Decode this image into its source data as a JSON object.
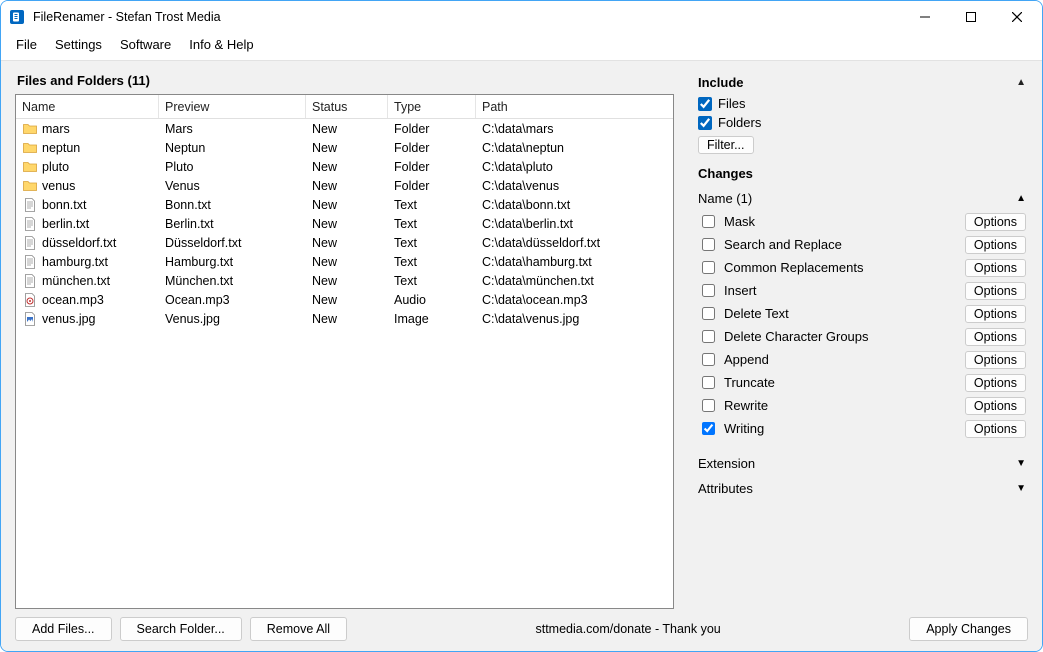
{
  "title": "FileRenamer - Stefan Trost Media",
  "menu": [
    "File",
    "Settings",
    "Software",
    "Info & Help"
  ],
  "files_section_title": "Files and Folders (11)",
  "columns": [
    "Name",
    "Preview",
    "Status",
    "Type",
    "Path"
  ],
  "rows": [
    {
      "icon": "folder",
      "name": "mars",
      "preview": "Mars",
      "status": "New",
      "type": "Folder",
      "path": "C:\\data\\mars"
    },
    {
      "icon": "folder",
      "name": "neptun",
      "preview": "Neptun",
      "status": "New",
      "type": "Folder",
      "path": "C:\\data\\neptun"
    },
    {
      "icon": "folder",
      "name": "pluto",
      "preview": "Pluto",
      "status": "New",
      "type": "Folder",
      "path": "C:\\data\\pluto"
    },
    {
      "icon": "folder",
      "name": "venus",
      "preview": "Venus",
      "status": "New",
      "type": "Folder",
      "path": "C:\\data\\venus"
    },
    {
      "icon": "text",
      "name": "bonn.txt",
      "preview": "Bonn.txt",
      "status": "New",
      "type": "Text",
      "path": "C:\\data\\bonn.txt"
    },
    {
      "icon": "text",
      "name": "berlin.txt",
      "preview": "Berlin.txt",
      "status": "New",
      "type": "Text",
      "path": "C:\\data\\berlin.txt"
    },
    {
      "icon": "text",
      "name": "düsseldorf.txt",
      "preview": "Düsseldorf.txt",
      "status": "New",
      "type": "Text",
      "path": "C:\\data\\düsseldorf.txt"
    },
    {
      "icon": "text",
      "name": "hamburg.txt",
      "preview": "Hamburg.txt",
      "status": "New",
      "type": "Text",
      "path": "C:\\data\\hamburg.txt"
    },
    {
      "icon": "text",
      "name": "münchen.txt",
      "preview": "München.txt",
      "status": "New",
      "type": "Text",
      "path": "C:\\data\\münchen.txt"
    },
    {
      "icon": "audio",
      "name": "ocean.mp3",
      "preview": "Ocean.mp3",
      "status": "New",
      "type": "Audio",
      "path": "C:\\data\\ocean.mp3"
    },
    {
      "icon": "image",
      "name": "venus.jpg",
      "preview": "Venus.jpg",
      "status": "New",
      "type": "Image",
      "path": "C:\\data\\venus.jpg"
    }
  ],
  "include": {
    "title": "Include",
    "files_label": "Files",
    "files_checked": true,
    "folders_label": "Folders",
    "folders_checked": true,
    "filter_button": "Filter..."
  },
  "changes": {
    "title": "Changes",
    "name_header": "Name (1)",
    "items": [
      {
        "label": "Mask",
        "checked": false
      },
      {
        "label": "Search and Replace",
        "checked": false
      },
      {
        "label": "Common Replacements",
        "checked": false
      },
      {
        "label": "Insert",
        "checked": false
      },
      {
        "label": "Delete Text",
        "checked": false
      },
      {
        "label": "Delete Character Groups",
        "checked": false
      },
      {
        "label": "Append",
        "checked": false
      },
      {
        "label": "Truncate",
        "checked": false
      },
      {
        "label": "Rewrite",
        "checked": false
      },
      {
        "label": "Writing",
        "checked": true
      }
    ],
    "options_label": "Options",
    "extension_header": "Extension",
    "attributes_header": "Attributes"
  },
  "bottom": {
    "add_files": "Add Files...",
    "search_folder": "Search Folder...",
    "remove_all": "Remove All",
    "donate": "sttmedia.com/donate - Thank you",
    "apply": "Apply Changes"
  }
}
